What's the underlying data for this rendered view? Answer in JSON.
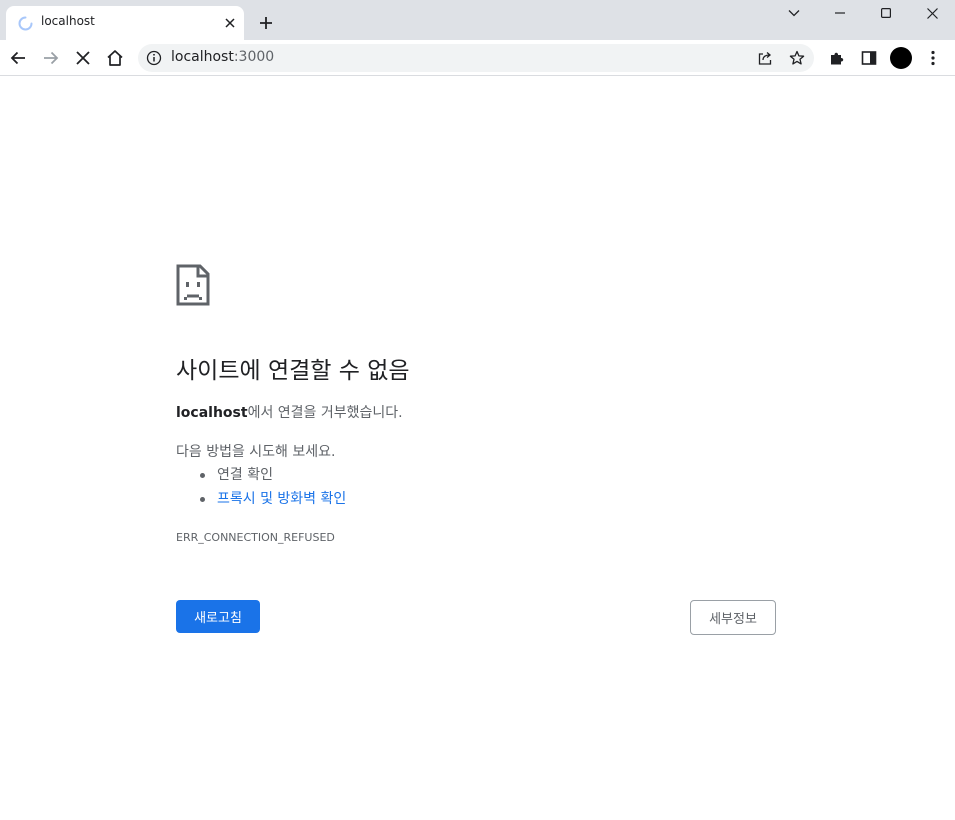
{
  "browser": {
    "tab": {
      "title": "localhost",
      "close_icon": "close-icon",
      "loading_icon": "spinner-icon"
    },
    "newtab_icon": "plus-icon",
    "window_controls": [
      "chevron-down-icon",
      "minimize-icon",
      "maximize-icon",
      "close-icon"
    ],
    "toolbar": {
      "back_icon": "arrow-left-icon",
      "forward_icon": "arrow-right-icon",
      "stop_icon": "stop-icon",
      "home_icon": "home-icon"
    },
    "omnibox": {
      "host": "localhost",
      "port": ":3000",
      "info_icon": "info-icon",
      "share_icon": "share-icon",
      "bookmark_icon": "star-icon"
    },
    "extensions_icon": "puzzle-icon",
    "sidepanel_icon": "side-panel-icon",
    "menu_icon": "kebab-menu-icon"
  },
  "error_page": {
    "icon": "sad-page-icon",
    "heading": "사이트에 연결할 수 없음",
    "host": "localhost",
    "description_suffix": "에서 연결을 거부했습니다.",
    "suggestions_title": "다음 방법을 시도해 보세요.",
    "suggestions": [
      {
        "label": "연결 확인"
      },
      {
        "label": "프록시 및 방화벽 확인"
      }
    ],
    "error_code": "ERR_CONNECTION_REFUSED",
    "reload_label": "새로고침",
    "details_label": "세부정보"
  },
  "colors": {
    "accent": "#1a73e8",
    "tabstrip": "#dee1e6",
    "text_secondary": "#5f6368"
  }
}
